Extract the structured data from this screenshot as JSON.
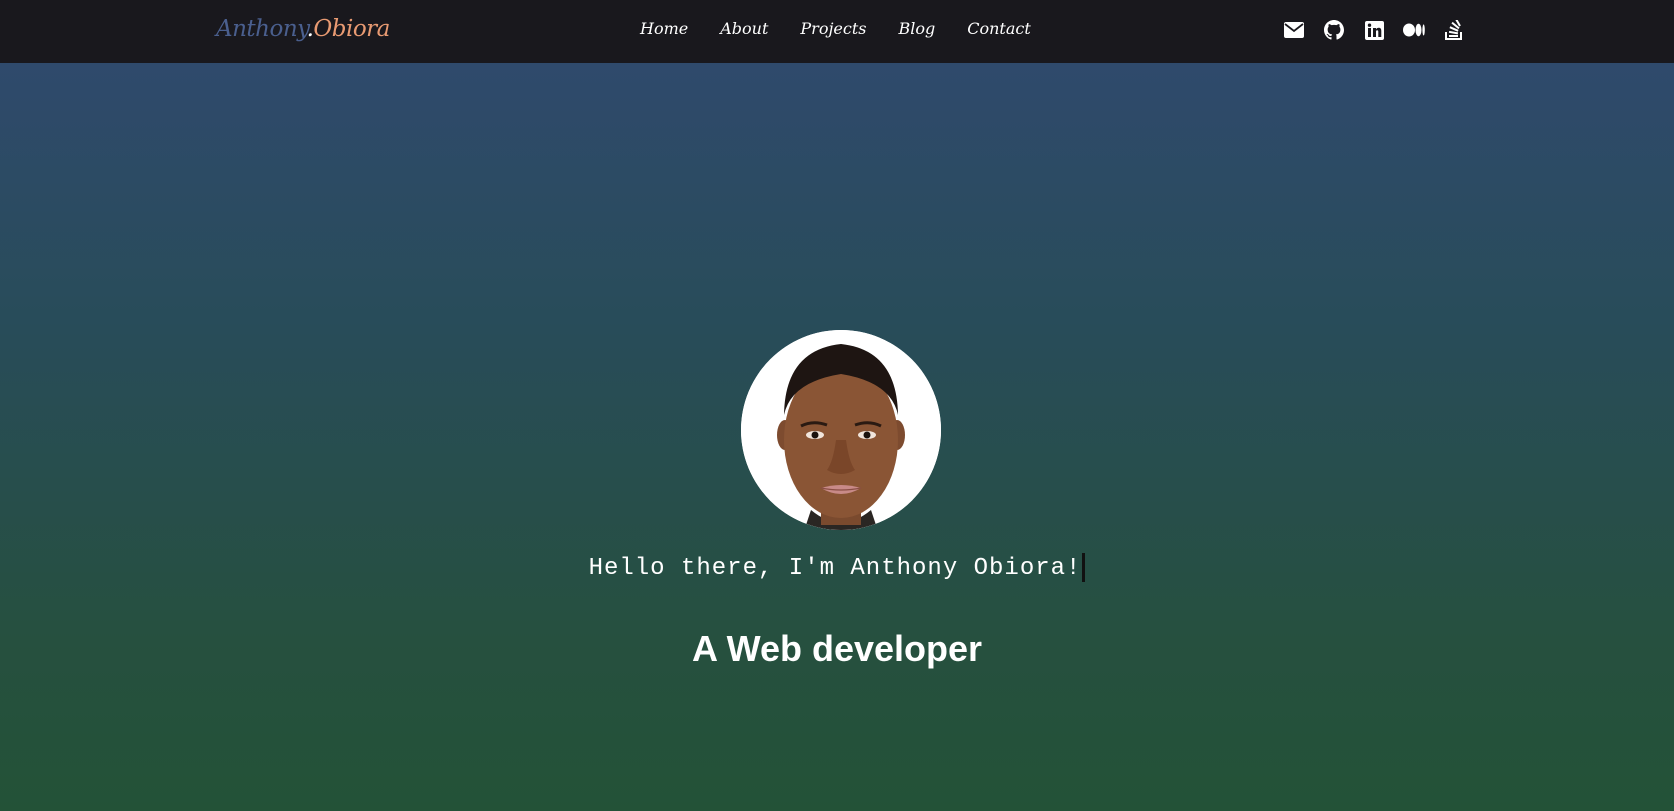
{
  "brand": {
    "first": "Anthony",
    "dot": ".",
    "last": "Obiora"
  },
  "nav": {
    "home": "Home",
    "about": "About",
    "projects": "Projects",
    "blog": "Blog",
    "contact": "Contact"
  },
  "socials": [
    "email-icon",
    "github-icon",
    "linkedin-icon",
    "medium-icon",
    "stackoverflow-icon"
  ],
  "colors": {
    "navbar": "#19181d",
    "brand_first": "#4a5f8e",
    "brand_last": "#e89a72",
    "gradient_top": "#2f4a6c",
    "gradient_bottom": "#235237"
  },
  "hero": {
    "greeting": "Hello there, I'm Anthony Obiora!",
    "role": "A Web developer"
  }
}
